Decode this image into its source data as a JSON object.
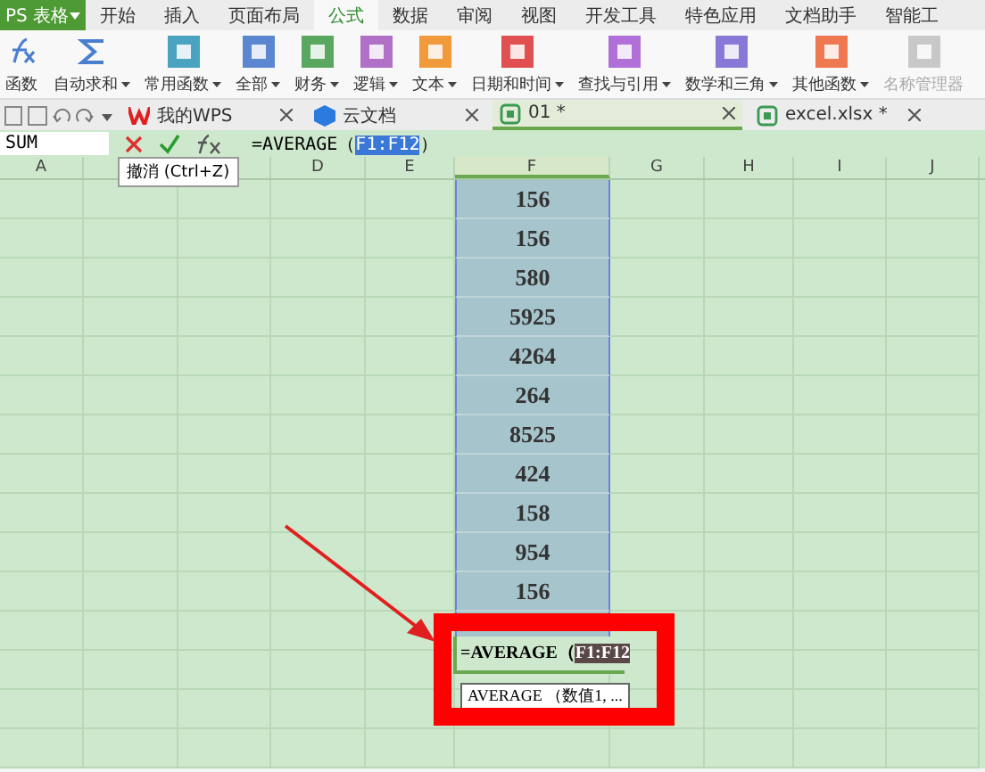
{
  "app_menu": {
    "label": "PS 表格"
  },
  "tabs": [
    {
      "label": "开始",
      "selected": false
    },
    {
      "label": "插入",
      "selected": false
    },
    {
      "label": "页面布局",
      "selected": false
    },
    {
      "label": "公式",
      "selected": true
    },
    {
      "label": "数据",
      "selected": false
    },
    {
      "label": "审阅",
      "selected": false
    },
    {
      "label": "视图",
      "selected": false
    },
    {
      "label": "开发工具",
      "selected": false
    },
    {
      "label": "特色应用",
      "selected": false
    },
    {
      "label": "文档助手",
      "selected": false
    },
    {
      "label": "智能工",
      "selected": false
    }
  ],
  "ribbon": [
    {
      "label": "函数",
      "kind": "fx",
      "color": "#4a7fd0",
      "disabled": false
    },
    {
      "label": "自动求和",
      "kind": "sigma",
      "color": "#4a7fd0",
      "disabled": false
    },
    {
      "label": "常用函数",
      "kind": "tile",
      "color": "#4aa3c0",
      "disabled": false
    },
    {
      "label": "全部",
      "kind": "tile",
      "color": "#5b86d0",
      "disabled": false
    },
    {
      "label": "财务",
      "kind": "tile",
      "color": "#5aa860",
      "disabled": false
    },
    {
      "label": "逻辑",
      "kind": "tile",
      "color": "#b070c8",
      "disabled": false
    },
    {
      "label": "文本",
      "kind": "tile",
      "color": "#f09a3c",
      "disabled": false
    },
    {
      "label": "日期和时间",
      "kind": "tile",
      "color": "#e05050",
      "disabled": false
    },
    {
      "label": "查找与引用",
      "kind": "tile",
      "color": "#b070d8",
      "disabled": false
    },
    {
      "label": "数学和三角",
      "kind": "tile",
      "color": "#8a78d8",
      "disabled": false
    },
    {
      "label": "其他函数",
      "kind": "tile",
      "color": "#f07850",
      "disabled": false
    },
    {
      "label": "名称管理器",
      "kind": "tile",
      "color": "#c8c8c8",
      "disabled": true
    }
  ],
  "doc_tabs": [
    {
      "label": "我的WPS",
      "kind": "wps",
      "selected": false
    },
    {
      "label": "云文档",
      "kind": "cloud",
      "selected": false
    },
    {
      "label": "01 *",
      "kind": "sheet",
      "selected": true
    },
    {
      "label": "excel.xlsx *",
      "kind": "sheet",
      "selected": false
    }
  ],
  "name_box": {
    "value": "SUM"
  },
  "formula_bar": {
    "before": "=AVERAGE（",
    "reference": "F1:F12",
    "after": "）"
  },
  "tooltip": {
    "text": "撤消 (Ctrl+Z)"
  },
  "columns": [
    {
      "label": "A",
      "selected": false
    },
    {},
    {},
    {
      "label": "D",
      "selected": false
    },
    {
      "label": "E",
      "selected": false
    },
    {
      "label": "F",
      "selected": true
    },
    {
      "label": "G",
      "selected": false
    },
    {
      "label": "H",
      "selected": false
    },
    {
      "label": "I",
      "selected": false
    },
    {
      "label": "J",
      "selected": false
    }
  ],
  "values": [
    "156",
    "156",
    "580",
    "5925",
    "4264",
    "264",
    "8525",
    "424",
    "158",
    "954",
    "156"
  ],
  "editing_cell": {
    "before": "=AVERAGE（",
    "reference": "F1:F12"
  },
  "function_hint": {
    "text": "AVERAGE （数值1, ..."
  }
}
